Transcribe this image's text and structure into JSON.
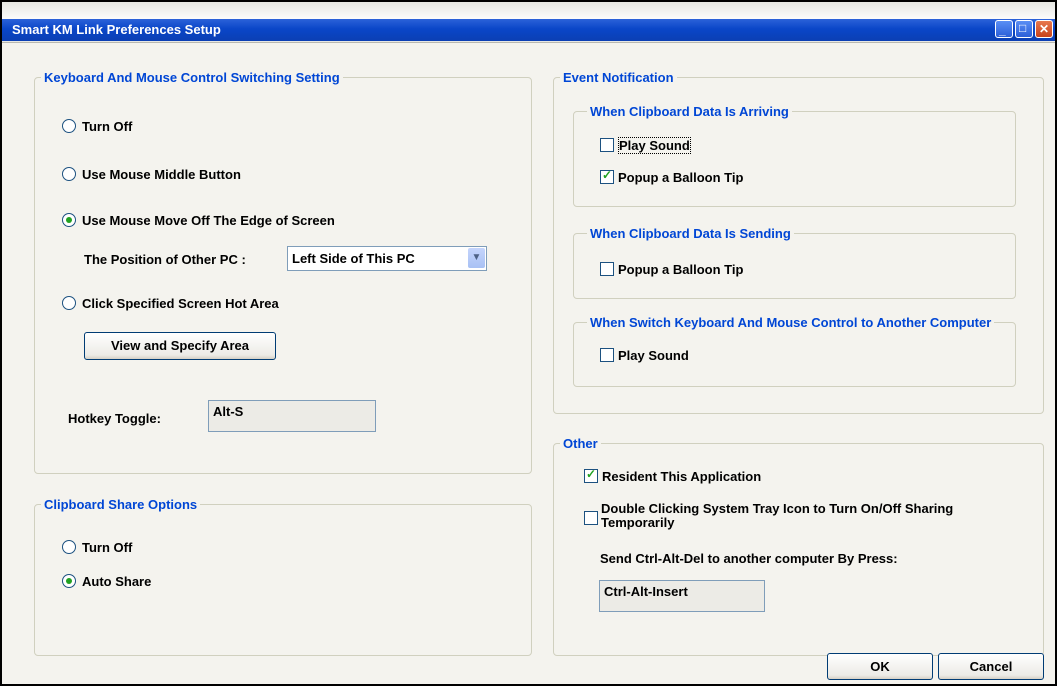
{
  "window": {
    "title": "Smart KM Link Preferences Setup"
  },
  "titlebar": {
    "min_glyph": "_",
    "max_glyph": "□",
    "close_glyph": "✕"
  },
  "kbm": {
    "legend": "Keyboard And Mouse Control Switching Setting",
    "turn_off": "Turn Off",
    "middle_button": "Use Mouse Middle Button",
    "move_off_edge": "Use Mouse Move Off The Edge of Screen",
    "position_label": "The Position of Other PC :",
    "position_value": "Left Side of This PC",
    "hot_area": "Click Specified Screen Hot Area",
    "view_button": "View and Specify Area",
    "hotkey_label": "Hotkey Toggle:",
    "hotkey_value": "Alt-S",
    "selected": "move_off_edge"
  },
  "clipboard": {
    "legend": "Clipboard Share Options",
    "turn_off": "Turn Off",
    "auto_share": "Auto Share",
    "selected": "auto_share"
  },
  "event": {
    "legend": "Event Notification",
    "arriving": {
      "legend": "When Clipboard Data Is Arriving",
      "play_sound": "Play Sound",
      "play_sound_checked": false,
      "balloon": "Popup a Balloon Tip",
      "balloon_checked": true
    },
    "sending": {
      "legend": "When Clipboard Data Is Sending",
      "balloon": "Popup a Balloon Tip",
      "balloon_checked": false
    },
    "switch": {
      "legend": "When Switch Keyboard And Mouse Control to Another Computer",
      "play_sound": "Play Sound",
      "play_sound_checked": false
    }
  },
  "other": {
    "legend": "Other",
    "resident": "Resident This Application",
    "resident_checked": true,
    "double_click_line1": "Double Clicking System Tray Icon to Turn On/Off Sharing",
    "double_click_line2": "Temporarily",
    "double_click_checked": false,
    "cad_label": "Send Ctrl-Alt-Del to another computer By Press:",
    "cad_value": "Ctrl-Alt-Insert"
  },
  "buttons": {
    "ok": "OK",
    "cancel": "Cancel"
  }
}
